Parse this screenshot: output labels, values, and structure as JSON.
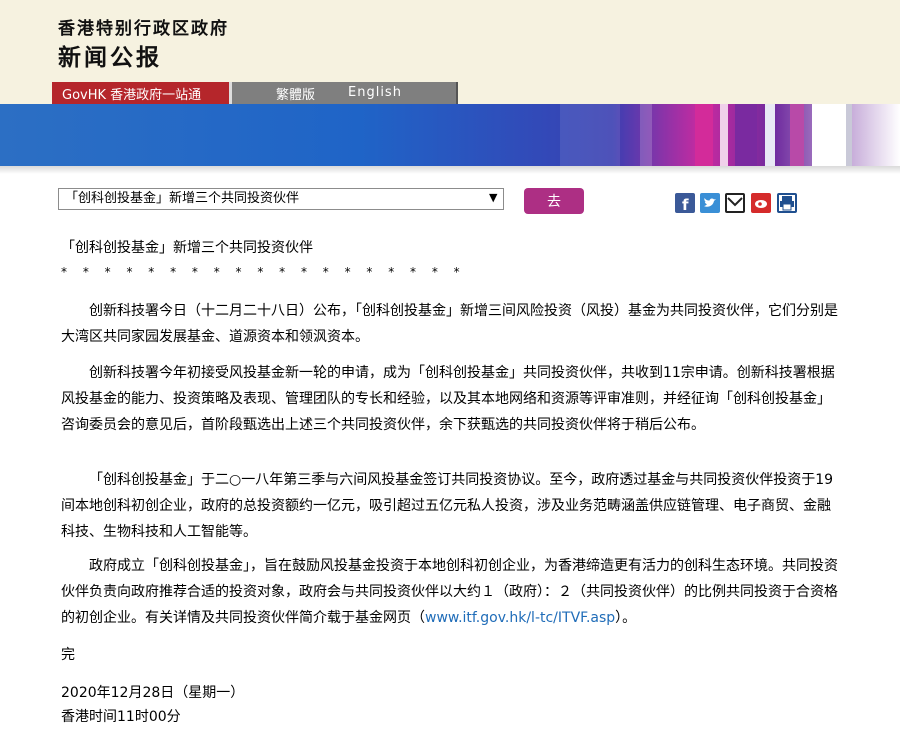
{
  "header": {
    "org_name": "香港特别行政区政府",
    "title": "新闻公报"
  },
  "nav": {
    "govhk": "GovHK 香港政府一站通",
    "traditional": "繁體版",
    "english": "English"
  },
  "toolbar": {
    "select_value": "「创科创投基金」新增三个共同投资伙伴",
    "go_label": "去",
    "share_icons": [
      "facebook-icon",
      "twitter-icon",
      "email-icon",
      "weibo-icon",
      "print-icon"
    ]
  },
  "article": {
    "title": "「创科创投基金」新增三个共同投资伙伴",
    "stars": "* * * * * * * * * * * * * * * * * * *",
    "para1": "创新科技署今日（十二月二十八日）公布，「创科创投基金」新增三间风险投资（风投）基金为共同投资伙伴，它们分别是大湾区共同家园发展基金、道源资本和领沨资本。",
    "para2": "创新科技署今年初接受风投基金新一轮的申请，成为「创科创投基金」共同投资伙伴，共收到11宗申请。创新科技署根据风投基金的能力、投资策略及表现、管理团队的专长和经验，以及其本地网络和资源等评审准则，并经征询「创科创投基金」咨询委员会的意见后，首阶段甄选出上述三个共同投资伙伴，余下获甄选的共同投资伙伴将于稍后公布。",
    "para3": "「创科创投基金」于二○一八年第三季与六间风投基金签订共同投资协议。至今，政府透过基金与共同投资伙伴投资于19间本地创科初创企业，政府的总投资额约一亿元，吸引超过五亿元私人投资，涉及业务范畴涵盖供应链管理、电子商贸、金融科技、生物科技和人工智能等。",
    "para4_pre": "政府成立「创科创投基金」，旨在鼓励风投基金投资于本地创科初创企业，为香港缔造更有活力的创科生态环境。共同投资伙伴负责向政府推荐合适的投资对象，政府会与共同投资伙伴以大约１（政府）：２（共同投资伙伴）的比例共同投资于合资格的初创企业。有关详情及共同投资伙伴简介载于基金网页（",
    "para4_link": "www.itf.gov.hk/l-tc/ITVF.asp",
    "para4_post": "）。",
    "end_mark": "完",
    "date": "2020年12月28日（星期一）",
    "time": "香港时间11时00分"
  }
}
